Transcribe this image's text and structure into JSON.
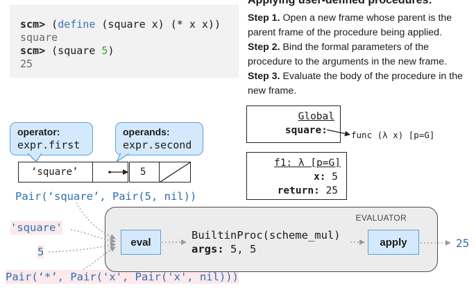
{
  "repl": {
    "prompt": "scm>",
    "line1_keyword": "define",
    "line1_open": "(",
    "line1_rest": " (square x) (* x x))",
    "line2": "square",
    "line3_text": "(square ",
    "line3_num": "5",
    "line3_close": ")",
    "line4": "25"
  },
  "rules": {
    "title": "Applying user-defined procedures:",
    "step1_label": "Step 1.",
    "step1_text": " Open a new frame whose parent is the parent frame of the procedure being applied.",
    "step2_label": "Step 2.",
    "step2_text": " Bind the formal parameters of the procedure to the arguments in the new frame.",
    "step3_label": "Step 3.",
    "step3_text": " Evaluate the body of the procedure in the new frame."
  },
  "global_frame": {
    "title": "Global",
    "binding_name": "square:",
    "binding_value": "func (λ x) [p=G]"
  },
  "f1_frame": {
    "title": "f1: λ [p=G]",
    "x_label": "x:",
    "x_value": "5",
    "return_label": "return:",
    "return_value": "25"
  },
  "operator_bubble": {
    "heading": "operator:",
    "code": "expr.first"
  },
  "operands_bubble": {
    "heading": "operands:",
    "code": "expr.second"
  },
  "pair_cells": {
    "first": "‘square’",
    "second_first": "5"
  },
  "pair_expr": "Pair(‘square’, Pair(5, nil))",
  "eval_inputs": {
    "operator": "'square'",
    "operand": "5",
    "body": "Pair(‘*’, Pair('x', Pair('x', nil)))"
  },
  "evaluator": {
    "label": "EVALUATOR",
    "eval_button": "eval",
    "builtin": "BuiltinProc(scheme_mul)",
    "args_label": "args:",
    "args_value": " 5, 5",
    "apply_button": "apply"
  },
  "result": "25",
  "colors": {
    "blue": "#2f6fb0",
    "pink_bg": "#fbe9ec",
    "bubble_bg": "#d4eafc",
    "bubble_border": "#5aa0d8",
    "green": "#4a9a3a"
  }
}
